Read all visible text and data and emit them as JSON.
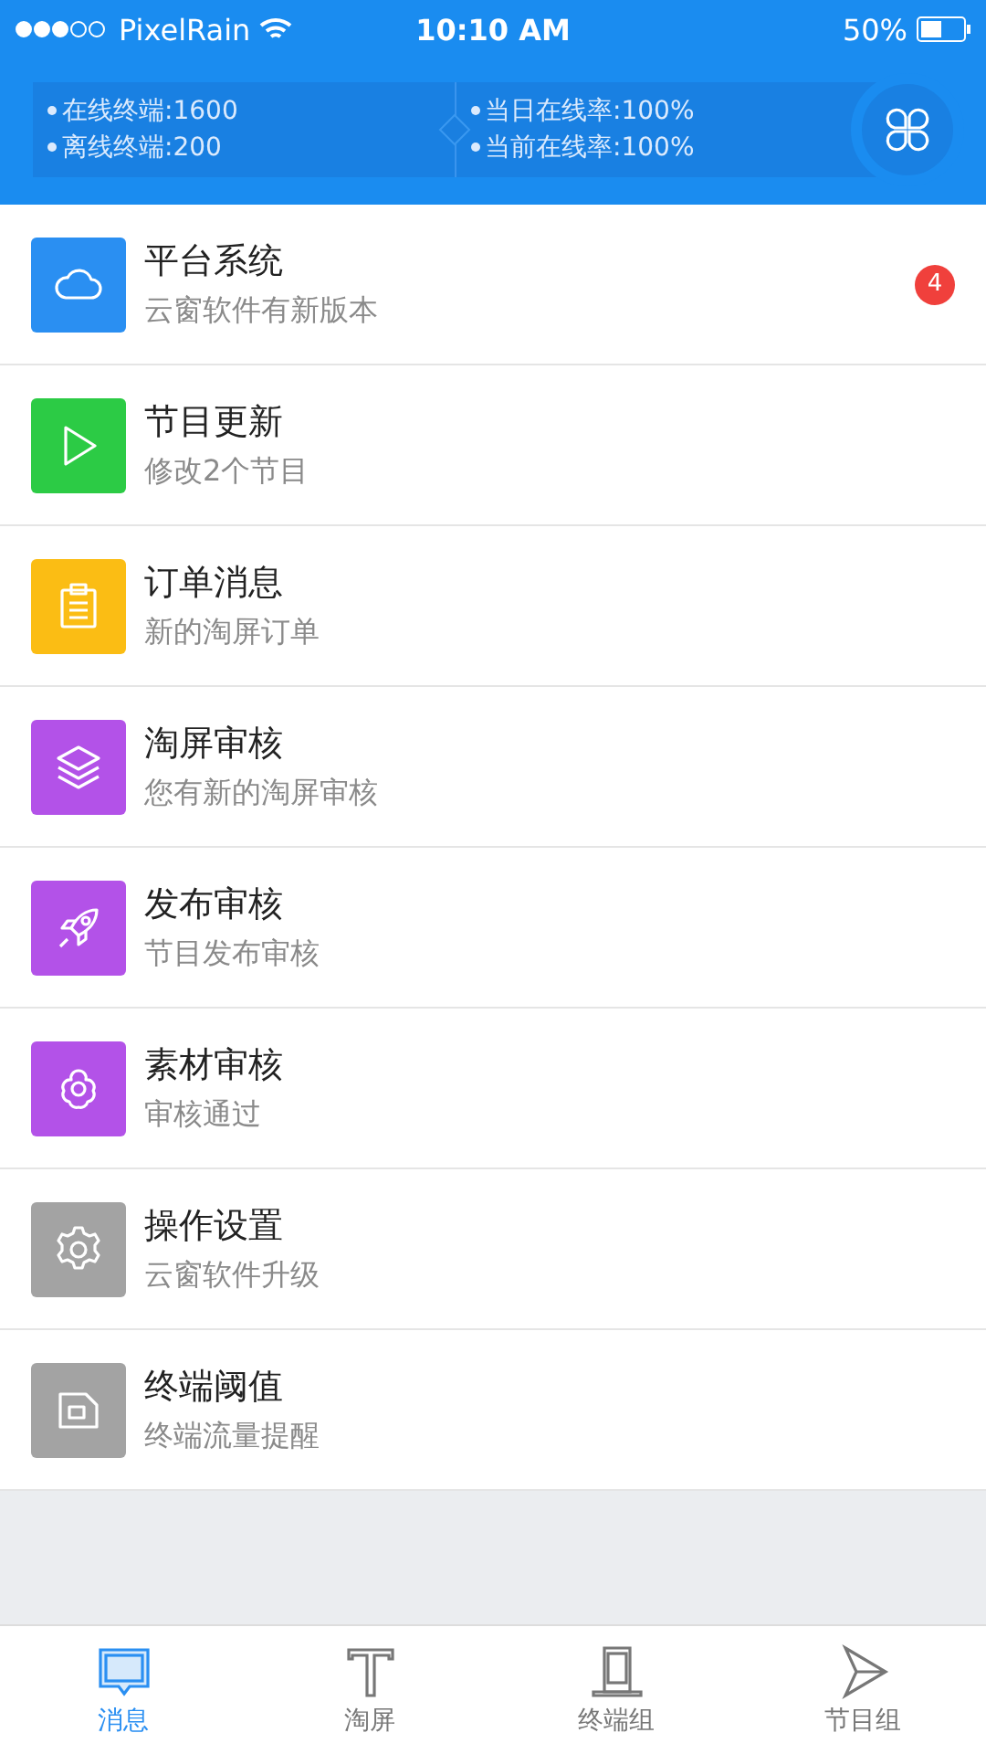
{
  "status_bar": {
    "carrier": "PixelRain",
    "time": "10:10 AM",
    "battery": "50%"
  },
  "summary": {
    "left": [
      "在线终端:1600",
      "离线终端:200"
    ],
    "right": [
      "当日在线率:100%",
      "当前在线率:100%"
    ]
  },
  "items": [
    {
      "kind": "cloud",
      "color": "#2a8ff2",
      "title": "平台系统",
      "subtitle": "云窗软件有新版本",
      "badge": "4"
    },
    {
      "kind": "play",
      "color": "#2ccb45",
      "title": "节目更新",
      "subtitle": "修改2个节目"
    },
    {
      "kind": "clipboard",
      "color": "#fbbd14",
      "title": "订单消息",
      "subtitle": "新的淘屏订单"
    },
    {
      "kind": "layers",
      "color": "#b352e8",
      "title": "淘屏审核",
      "subtitle": "您有新的淘屏审核"
    },
    {
      "kind": "rocket",
      "color": "#b352e8",
      "title": "发布审核",
      "subtitle": "节目发布审核"
    },
    {
      "kind": "flower",
      "color": "#b352e8",
      "title": "素材审核",
      "subtitle": "审核通过"
    },
    {
      "kind": "gear",
      "color": "#a3a3a3",
      "title": "操作设置",
      "subtitle": "云窗软件升级"
    },
    {
      "kind": "card",
      "color": "#a3a3a3",
      "title": "终端阈值",
      "subtitle": "终端流量提醒"
    }
  ],
  "tabs": [
    {
      "kind": "message",
      "label": "消息",
      "selected": true
    },
    {
      "kind": "text",
      "label": "淘屏",
      "selected": false
    },
    {
      "kind": "device",
      "label": "终端组",
      "selected": false
    },
    {
      "kind": "send",
      "label": "节目组",
      "selected": false
    }
  ]
}
